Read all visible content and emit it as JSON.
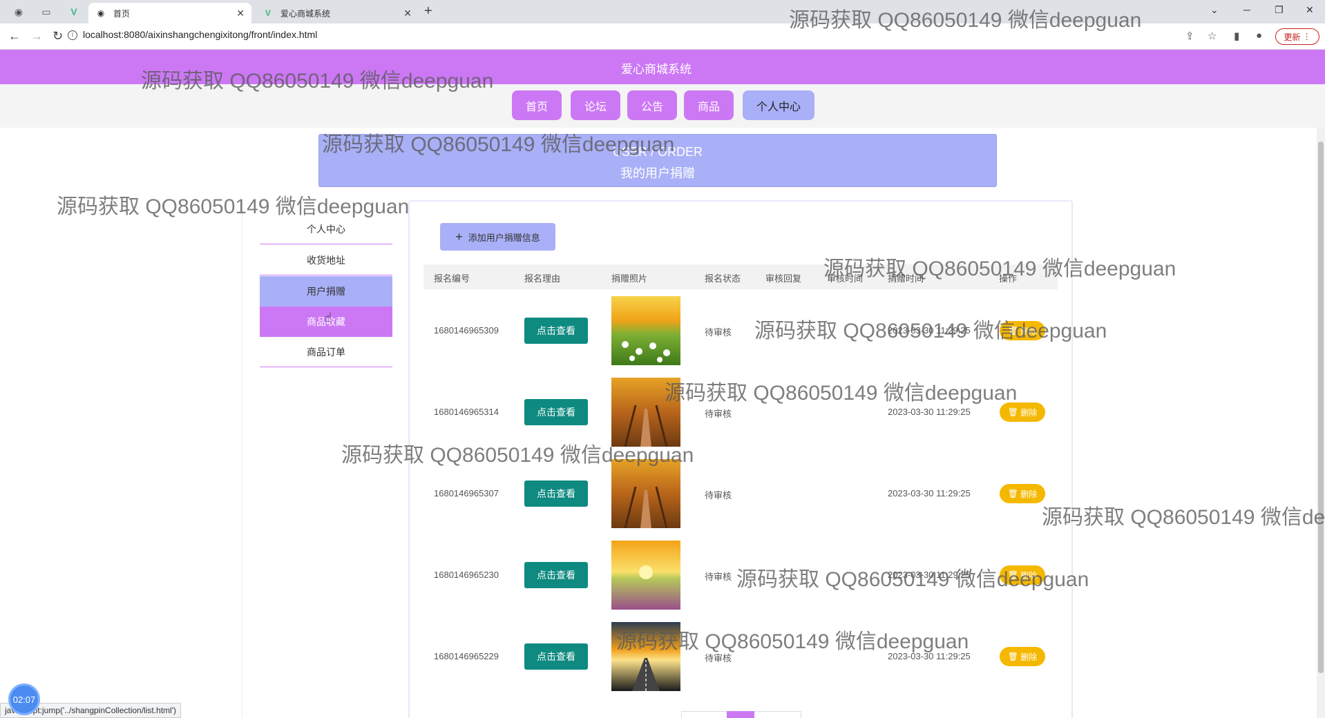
{
  "browser": {
    "tabs": [
      {
        "title": "首页",
        "active": true
      },
      {
        "title": "爱心商城系统",
        "active": false
      }
    ],
    "url": "localhost:8080/aixinshangchengixitong/front/index.html",
    "update_label": "更新"
  },
  "site": {
    "title": "爱心商城系统",
    "nav": [
      "首页",
      "论坛",
      "公告",
      "商品",
      "个人中心"
    ],
    "active_nav": "个人中心"
  },
  "banner": {
    "en": "USER / ORDER",
    "cn": "我的用户捐赠"
  },
  "sidebar": {
    "items": [
      "个人中心",
      "收货地址",
      "用户捐赠",
      "商品收藏",
      "商品订单"
    ]
  },
  "main": {
    "add_button": "添加用户捐赠信息",
    "columns": [
      "报名编号",
      "报名理由",
      "捐赠照片",
      "报名状态",
      "审核回复",
      "审核时间",
      "捐赠时间",
      "操作"
    ],
    "view_label": "点击查看",
    "delete_label": "删除",
    "rows": [
      {
        "id": "1680146965309",
        "status": "待审核",
        "time": "2023-03-30 11:29:25",
        "photo": "daisy-field"
      },
      {
        "id": "1680146965314",
        "status": "待审核",
        "time": "2023-03-30 11:29:25",
        "photo": "autumn-road"
      },
      {
        "id": "1680146965307",
        "status": "待审核",
        "time": "2023-03-30 11:29:25",
        "photo": "autumn-road"
      },
      {
        "id": "1680146965230",
        "status": "待审核",
        "time": "2023-03-30 11:29:25",
        "photo": "sunset-meadow"
      },
      {
        "id": "1680146965229",
        "status": "待审核",
        "time": "2023-03-30 11:29:25",
        "photo": "sunset-highway"
      }
    ]
  },
  "status_bar": "javascript:jump('../shangpinCollection/list.html')",
  "timer": "02:07",
  "watermark": "源码获取 QQ86050149 微信deepguan",
  "colors": {
    "header": "#cc78f5",
    "accent": "#a9b0f7",
    "teal": "#0f8a80",
    "delete": "#f5b800"
  }
}
